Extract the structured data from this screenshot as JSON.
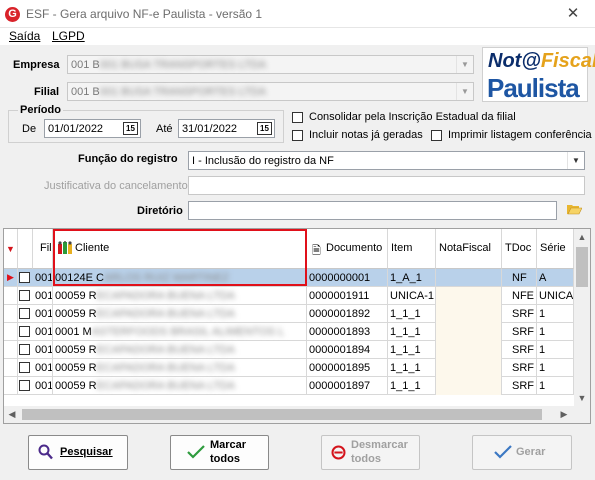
{
  "window": {
    "title": "ESF - Gera arquivo NF-e Paulista - versão 1",
    "app_icon": "G",
    "close_glyph": "✕"
  },
  "menu": {
    "items": [
      "Saída",
      "LGPD"
    ]
  },
  "form": {
    "empresa_label": "Empresa",
    "empresa_value": "001 BUSA TRANSPORTES LTDA",
    "filial_label": "Filial",
    "filial_value": "001 BUSA TRANSPORTES LTDA",
    "periodo_label": "Período",
    "de_label": "De",
    "de_value": "01/01/2022",
    "ate_label": "Até",
    "ate_value": "31/01/2022",
    "calendar_glyph": "15",
    "consolidar_label": "Consolidar pela Inscrição Estadual da filial",
    "incluir_label": "Incluir notas já geradas",
    "imprimir_label": "Imprimir listagem conferência",
    "funcao_label": "Função do registro",
    "funcao_value": "I - Inclusão do registro da NF",
    "justificativa_label": "Justificativa do cancelamento",
    "justificativa_value": "",
    "diretorio_label": "Diretório",
    "diretorio_value": ""
  },
  "logo": {
    "line1_a": "Not@",
    "line1_b": "Fiscal",
    "line2": "Paulista"
  },
  "grid": {
    "headers": {
      "fil": "Fil",
      "cliente": "Cliente",
      "documento": "Documento",
      "item": "Item",
      "notafiscal": "NotaFiscal",
      "tdoc": "TDoc",
      "serie": "Série"
    },
    "rows": [
      {
        "fil": "001",
        "cliente": "00124E CARLOS RUIZ MARTINEZ",
        "documento": "0000000001",
        "item": "1_A_1",
        "notafiscal": "",
        "tdoc": "NF",
        "serie": "A"
      },
      {
        "fil": "001",
        "cliente": "00059 RECAPADORA BUENA LTDA",
        "documento": "0000001911",
        "item": "UNICA-1",
        "notafiscal": "",
        "tdoc": "NFE",
        "serie": "UNICA"
      },
      {
        "fil": "001",
        "cliente": "00059 RECAPADORA BUENA LTDA",
        "documento": "0000001892",
        "item": "1_1_1",
        "notafiscal": "",
        "tdoc": "SRF",
        "serie": "1"
      },
      {
        "fil": "001",
        "cliente": "0001 MASTERFOODS BRASIL ALIMENTOS L",
        "documento": "0000001893",
        "item": "1_1_1",
        "notafiscal": "",
        "tdoc": "SRF",
        "serie": "1"
      },
      {
        "fil": "001",
        "cliente": "00059 RECAPADORA BUENA LTDA",
        "documento": "0000001894",
        "item": "1_1_1",
        "notafiscal": "",
        "tdoc": "SRF",
        "serie": "1"
      },
      {
        "fil": "001",
        "cliente": "00059 RECAPADORA BUENA LTDA",
        "documento": "0000001895",
        "item": "1_1_1",
        "notafiscal": "",
        "tdoc": "SRF",
        "serie": "1"
      },
      {
        "fil": "001",
        "cliente": "00059 RECAPADORA BUENA LTDA",
        "documento": "0000001897",
        "item": "1_1_1",
        "notafiscal": "",
        "tdoc": "SRF",
        "serie": "1"
      }
    ]
  },
  "buttons": {
    "pesquisar": "Pesquisar",
    "marcar_l1": "Marcar",
    "marcar_l2": "todos",
    "desmarcar_l1": "Desmarcar",
    "desmarcar_l2": "todos",
    "gerar": "Gerar"
  },
  "colors": {
    "selected_row": "#b9d1ea",
    "highlight": "#e0101a",
    "row_alt": "#fdf8ec"
  }
}
